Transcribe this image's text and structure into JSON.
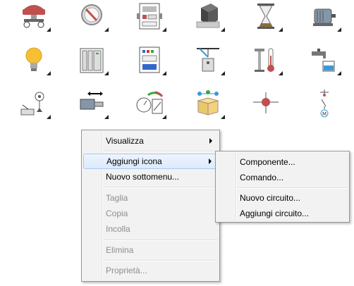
{
  "icons": [
    {
      "name": "emergency-stop-button-icon"
    },
    {
      "name": "gauge-knob-icon"
    },
    {
      "name": "control-panel-icon"
    },
    {
      "name": "cube-block-icon"
    },
    {
      "name": "hourglass-icon"
    },
    {
      "name": "electric-motor-icon"
    },
    {
      "name": "light-bulb-icon"
    },
    {
      "name": "electrical-cabinet-icon"
    },
    {
      "name": "plc-module-icon"
    },
    {
      "name": "hoist-crane-icon"
    },
    {
      "name": "thermometer-icon"
    },
    {
      "name": "water-tap-level-icon"
    },
    {
      "name": "sensor-antenna-icon"
    },
    {
      "name": "linear-actuator-icon"
    },
    {
      "name": "meter-instrument-icon"
    },
    {
      "name": "network-box-icon"
    },
    {
      "name": "circuit-node-icon"
    },
    {
      "name": "motor-contact-symbol-icon"
    }
  ],
  "context_menu": {
    "items": [
      {
        "label": "Visualizza",
        "has_submenu": true,
        "disabled": false
      },
      {
        "label": "Aggiungi icona",
        "has_submenu": true,
        "disabled": false,
        "highlighted": true
      },
      {
        "label": "Nuovo sottomenu...",
        "has_submenu": false,
        "disabled": false
      },
      {
        "label": "Taglia",
        "has_submenu": false,
        "disabled": true
      },
      {
        "label": "Copia",
        "has_submenu": false,
        "disabled": true
      },
      {
        "label": "Incolla",
        "has_submenu": false,
        "disabled": true
      },
      {
        "label": "Elimina",
        "has_submenu": false,
        "disabled": true
      },
      {
        "label": "Proprietà...",
        "has_submenu": false,
        "disabled": true
      }
    ]
  },
  "submenu": {
    "items": [
      {
        "label": "Componente..."
      },
      {
        "label": "Comando..."
      },
      {
        "label": "Nuovo circuito..."
      },
      {
        "label": "Aggiungi circuito..."
      }
    ]
  },
  "colors": {
    "menu_bg": "#f2f2f2",
    "highlight_border": "#a9c9f1",
    "disabled_text": "#8d8d8d"
  }
}
